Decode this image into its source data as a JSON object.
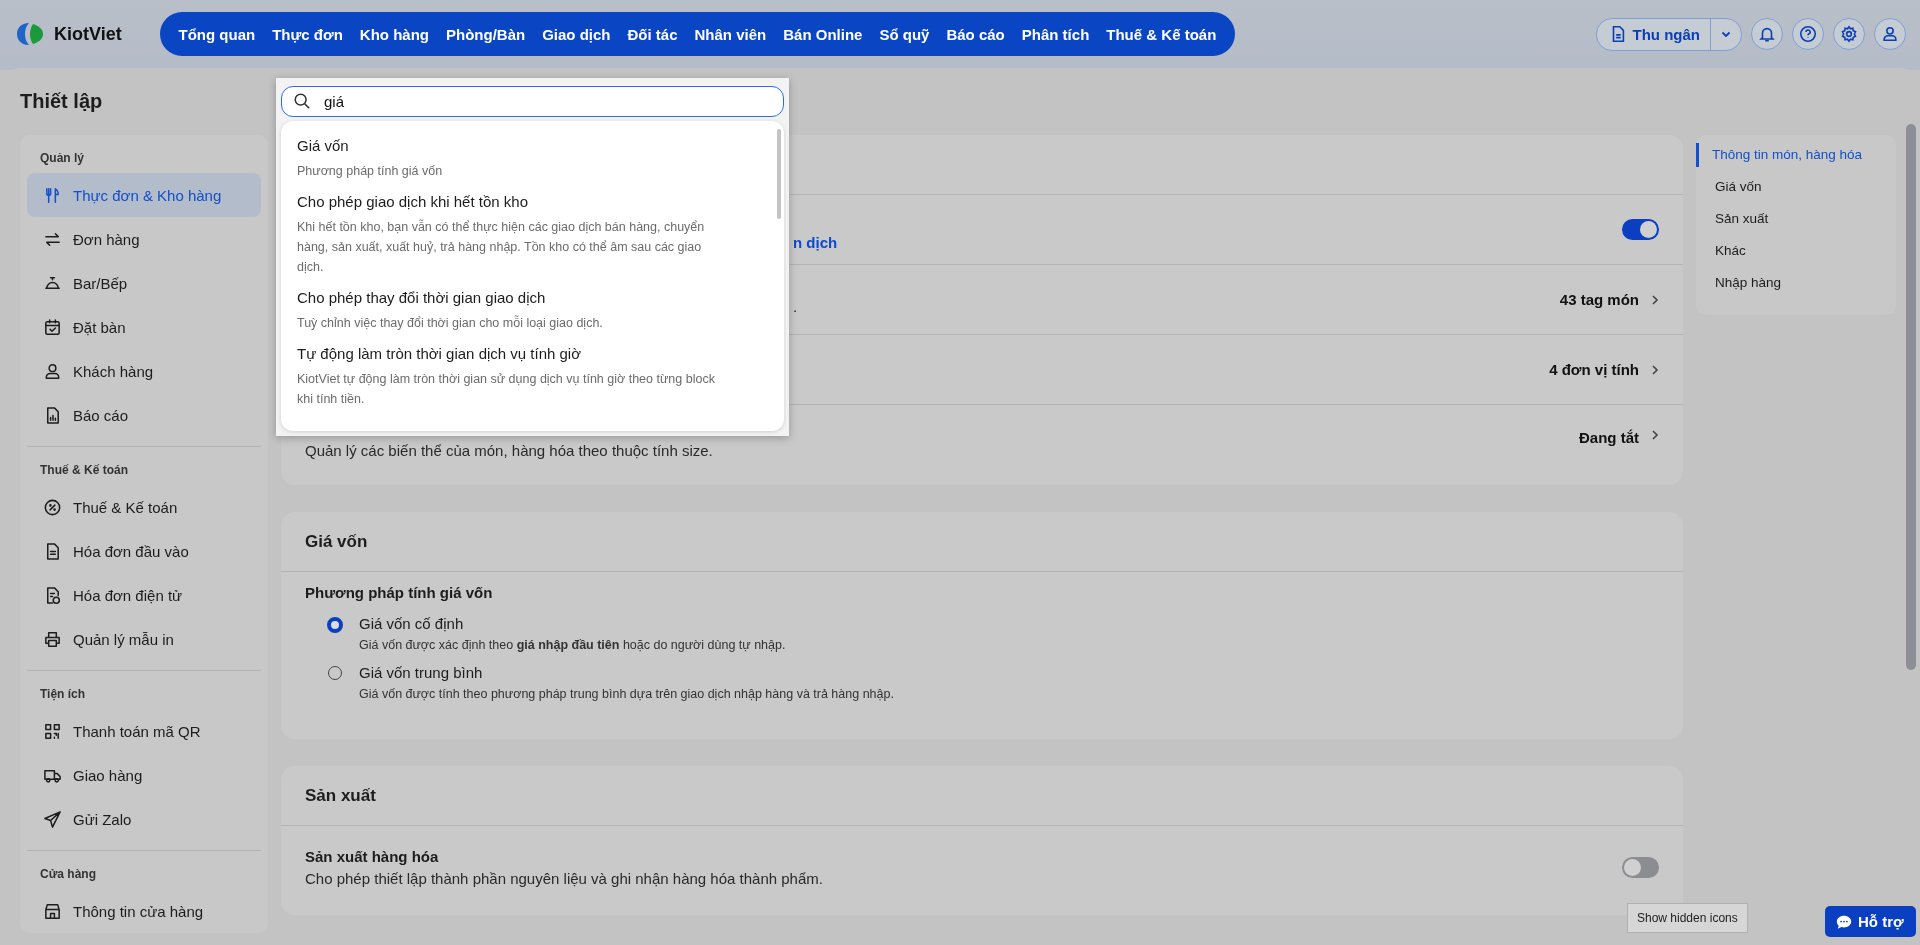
{
  "app": {
    "logo": "KiotViet"
  },
  "nav": [
    "Tổng quan",
    "Thực đơn",
    "Kho hàng",
    "Phòng/Bàn",
    "Giao dịch",
    "Đối tác",
    "Nhân viên",
    "Bán Online",
    "Sổ quỹ",
    "Báo cáo",
    "Phân tích",
    "Thuế & Kế toán"
  ],
  "header_actions": {
    "role_button": "Thu ngân"
  },
  "page_title": "Thiết lập",
  "sidebar": [
    {
      "title": "Quản lý",
      "items": [
        {
          "label": "Thực đơn & Kho hàng",
          "kind": "utensils",
          "selected": true
        },
        {
          "label": "Đơn hàng",
          "kind": "arrows",
          "selected": false
        },
        {
          "label": "Bar/Bếp",
          "kind": "cloche",
          "selected": false
        },
        {
          "label": "Đặt bàn",
          "kind": "calendar",
          "selected": false
        },
        {
          "label": "Khách hàng",
          "kind": "user",
          "selected": false
        },
        {
          "label": "Báo cáo",
          "kind": "report",
          "selected": false
        }
      ]
    },
    {
      "title": "Thuế & Kế toán",
      "items": [
        {
          "label": "Thuế & Kế toán",
          "kind": "percent",
          "selected": false
        },
        {
          "label": "Hóa đơn đầu vào",
          "kind": "document",
          "selected": false
        },
        {
          "label": "Hóa đơn điện tử",
          "kind": "einvoice",
          "selected": false
        },
        {
          "label": "Quản lý mẫu in",
          "kind": "printer",
          "selected": false
        }
      ]
    },
    {
      "title": "Tiện ích",
      "items": [
        {
          "label": "Thanh toán mã QR",
          "kind": "qr",
          "selected": false
        },
        {
          "label": "Giao hàng",
          "kind": "truck",
          "selected": false
        },
        {
          "label": "Gửi Zalo",
          "kind": "send",
          "selected": false
        }
      ]
    },
    {
      "title": "Cửa hàng",
      "items": [
        {
          "label": "Thông tin cửa hàng",
          "kind": "store",
          "selected": false
        }
      ]
    }
  ],
  "settings_cards": [
    {
      "kind": "rows",
      "rows": [
        {
          "kind": "toggle",
          "fragment": "n dịch",
          "on": true
        },
        {
          "kind": "link",
          "fragment": ".",
          "value": "43 tag món"
        },
        {
          "kind": "link",
          "value": "4 đơn vị tính"
        },
        {
          "kind": "link",
          "description": "Quản lý các biến thể của món, hàng hóa theo thuộc tính size.",
          "value": "Đang tắt"
        }
      ]
    },
    {
      "kind": "radio",
      "title": "Giá vốn",
      "subtitle": "Phương pháp tính giá vốn",
      "options": [
        {
          "label": "Giá vốn cố định",
          "description": "Giá vốn được xác định theo **giá nhập đầu tiên** hoặc do người dùng tự nhập.",
          "selected": true
        },
        {
          "label": "Giá vốn trung bình",
          "description": "Giá vốn được tính theo phương pháp trung bình dựa trên giao dịch nhập hàng và trả hàng nhập.",
          "selected": false
        }
      ]
    },
    {
      "kind": "rows",
      "title": "Sản xuất",
      "rows": [
        {
          "kind": "toggle",
          "title": "Sản xuất hàng hóa",
          "description": "Cho phép thiết lập thành phần nguyên liệu và ghi nhận hàng hóa thành phẩm.",
          "on": false
        }
      ]
    }
  ],
  "right_nav": [
    {
      "label": "Thông tin món, hàng hóa",
      "selected": true
    },
    {
      "label": "Giá vốn",
      "selected": false
    },
    {
      "label": "Sản xuất",
      "selected": false
    },
    {
      "label": "Khác",
      "selected": false
    },
    {
      "label": "Nhập hàng",
      "selected": false
    }
  ],
  "search": {
    "value": "giá",
    "results": [
      {
        "title": "Giá vốn",
        "description": "Phương pháp tính giá vốn"
      },
      {
        "title": "Cho phép giao dịch khi hết tồn kho",
        "description": "Khi hết tồn kho, bạn vẫn có thể thực hiện các giao dịch bán hàng, chuyển hàng, sản xuất, xuất huỷ, trả hàng nhập. Tồn kho có thể âm sau các giao dịch."
      },
      {
        "title": "Cho phép thay đổi thời gian giao dịch",
        "description": "Tuỳ chỉnh việc thay đổi thời gian cho mỗi loại giao dịch."
      },
      {
        "title": "Tự động làm tròn thời gian dịch vụ tính giờ",
        "description": "KiotViet tự động làm tròn thời gian sử dụng dịch vụ tính giờ theo từng block khi tính tiền."
      }
    ]
  },
  "tooltip": "Show hidden icons",
  "support_button": "Hỗ trợ"
}
